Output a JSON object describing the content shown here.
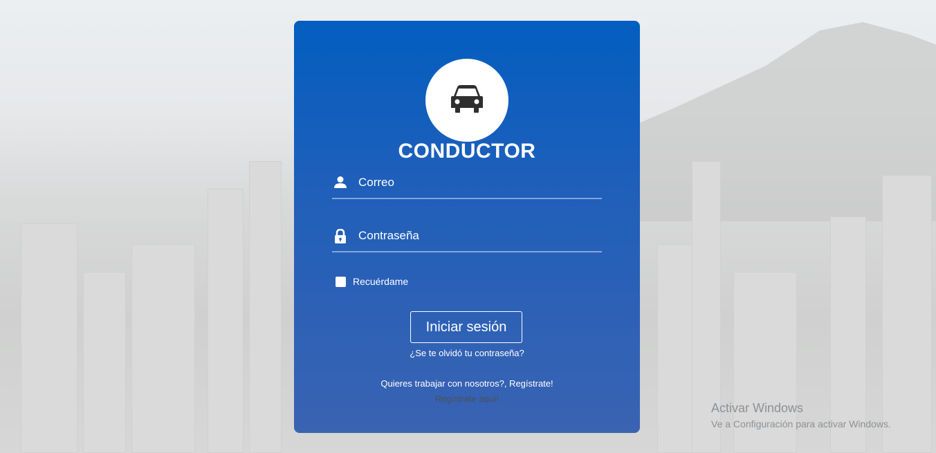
{
  "card": {
    "title": "CONDUCTOR",
    "avatar_icon": "car-icon",
    "email_field": {
      "placeholder": "Correo",
      "icon": "user-icon"
    },
    "password_field": {
      "placeholder": "Contraseña",
      "icon": "lock-icon"
    },
    "remember_label": "Recuérdame",
    "login_button": "Iniciar sesión",
    "forgot_link": "¿Se te olvidó tu contraseña?",
    "work_text": "Quieres trabajar con nosotros?, Regístrate!",
    "register_link": "Regístrate aquí!"
  },
  "watermark": {
    "line1": "Activar Windows",
    "line2": "Ve a Configuración para activar Windows."
  },
  "colors": {
    "card_top": "#035ec0",
    "card_bottom": "#3a63b2",
    "background": "#d8d9d9"
  }
}
